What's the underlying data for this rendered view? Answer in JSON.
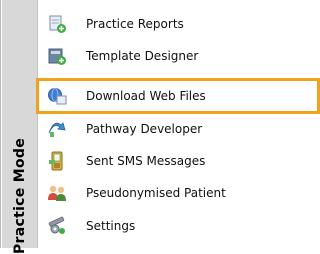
{
  "mode_label": "Practice Mode",
  "menu": {
    "items": [
      {
        "label": "Practice Reports",
        "icon": "practice-reports-icon"
      },
      {
        "label": "Template Designer",
        "icon": "template-designer-icon"
      },
      {
        "label": "Download Web Files",
        "icon": "download-web-files-icon"
      },
      {
        "label": "Pathway Developer",
        "icon": "pathway-developer-icon"
      },
      {
        "label": "Sent SMS Messages",
        "icon": "sms-messages-icon"
      },
      {
        "label": "Pseudonymised Patient",
        "icon": "pseudonymised-patient-icon"
      },
      {
        "label": "Settings",
        "icon": "settings-icon"
      }
    ],
    "highlighted_index": 2
  },
  "colors": {
    "highlight": "#f0a21a",
    "mode_bar": "#d8d8d8"
  }
}
